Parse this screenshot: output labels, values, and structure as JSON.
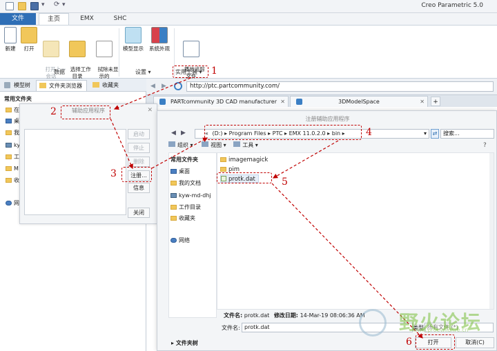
{
  "app": {
    "title": "Creo Parametric 5.0"
  },
  "menu_tabs": [
    "文件",
    "主页",
    "EMX",
    "SHC"
  ],
  "ribbon": {
    "buttons": [
      {
        "label": "新建"
      },
      {
        "label": "打开"
      },
      {
        "label": "打开上一\n会话"
      },
      {
        "label": "选择工作\n目录"
      },
      {
        "label": "拭除未显\n示的"
      },
      {
        "label": "模型显示"
      },
      {
        "label": "系统外观"
      },
      {
        "label": "播放追踪\n文件"
      }
    ],
    "groups": {
      "data": "数据",
      "settings": "设置 ▾",
      "utilities": "实用工具 ▾"
    }
  },
  "left_panel": {
    "tabs": [
      "模型树",
      "文件夹浏览器",
      "收藏夹"
    ],
    "section": "常用文件夹",
    "items": [
      "在",
      "桌",
      "我",
      "ky",
      "工",
      "M",
      "收",
      "网"
    ]
  },
  "browser": {
    "url": "http://ptc.partcommunity.com/",
    "tabs": [
      "PARTcommunity 3D CAD manufacturer cata",
      "3DModelSpace"
    ],
    "new_tab": "+"
  },
  "aux_dialog": {
    "title": "辅助应用程序",
    "columns": [
      "名称",
      "状况"
    ],
    "buttons": {
      "start": "启动",
      "stop": "停止",
      "delete": "删除",
      "register": "注册...",
      "info": "信息",
      "close": "关闭"
    }
  },
  "register_dialog": {
    "title": "注册辅助应用程序",
    "path": [
      "(D:)",
      "Program Files",
      "PTC",
      "EMX 11.0.2.0",
      "bin"
    ],
    "path_prefix": "«",
    "search_placeholder": "搜索...",
    "toolbar": {
      "organize": "组织 ▾",
      "view": "视图 ▾",
      "tools": "工具 ▾"
    },
    "nav_header": "常用文件夹",
    "nav_items": [
      "桌面",
      "我的文档",
      "kyw-md-dhj",
      "工作目录",
      "收藏夹",
      "网络"
    ],
    "files": [
      "imagemagick",
      "pim",
      "protk.dat"
    ],
    "file_info": {
      "name_label": "文件名:",
      "name": "protk.dat",
      "modified_label": "修改日期:",
      "modified": "14-Mar-19 08:06:36 AM"
    },
    "filename_label": "文件名:",
    "filename_value": "protk.dat",
    "type_label": "类型",
    "type_value": "所有文件 (*)",
    "tree_label": "文件夹树",
    "open_button": "打开",
    "cancel_button": "取消(C)"
  },
  "annotations": [
    "1",
    "2",
    "3",
    "4",
    "5",
    "6"
  ],
  "watermark": {
    "text": "野火论坛",
    "sub": "www.proewildfire.cn"
  },
  "colors": {
    "file_tab": "#2f6fb6",
    "annotation": "#c00000",
    "folder": "#f1c75a"
  }
}
